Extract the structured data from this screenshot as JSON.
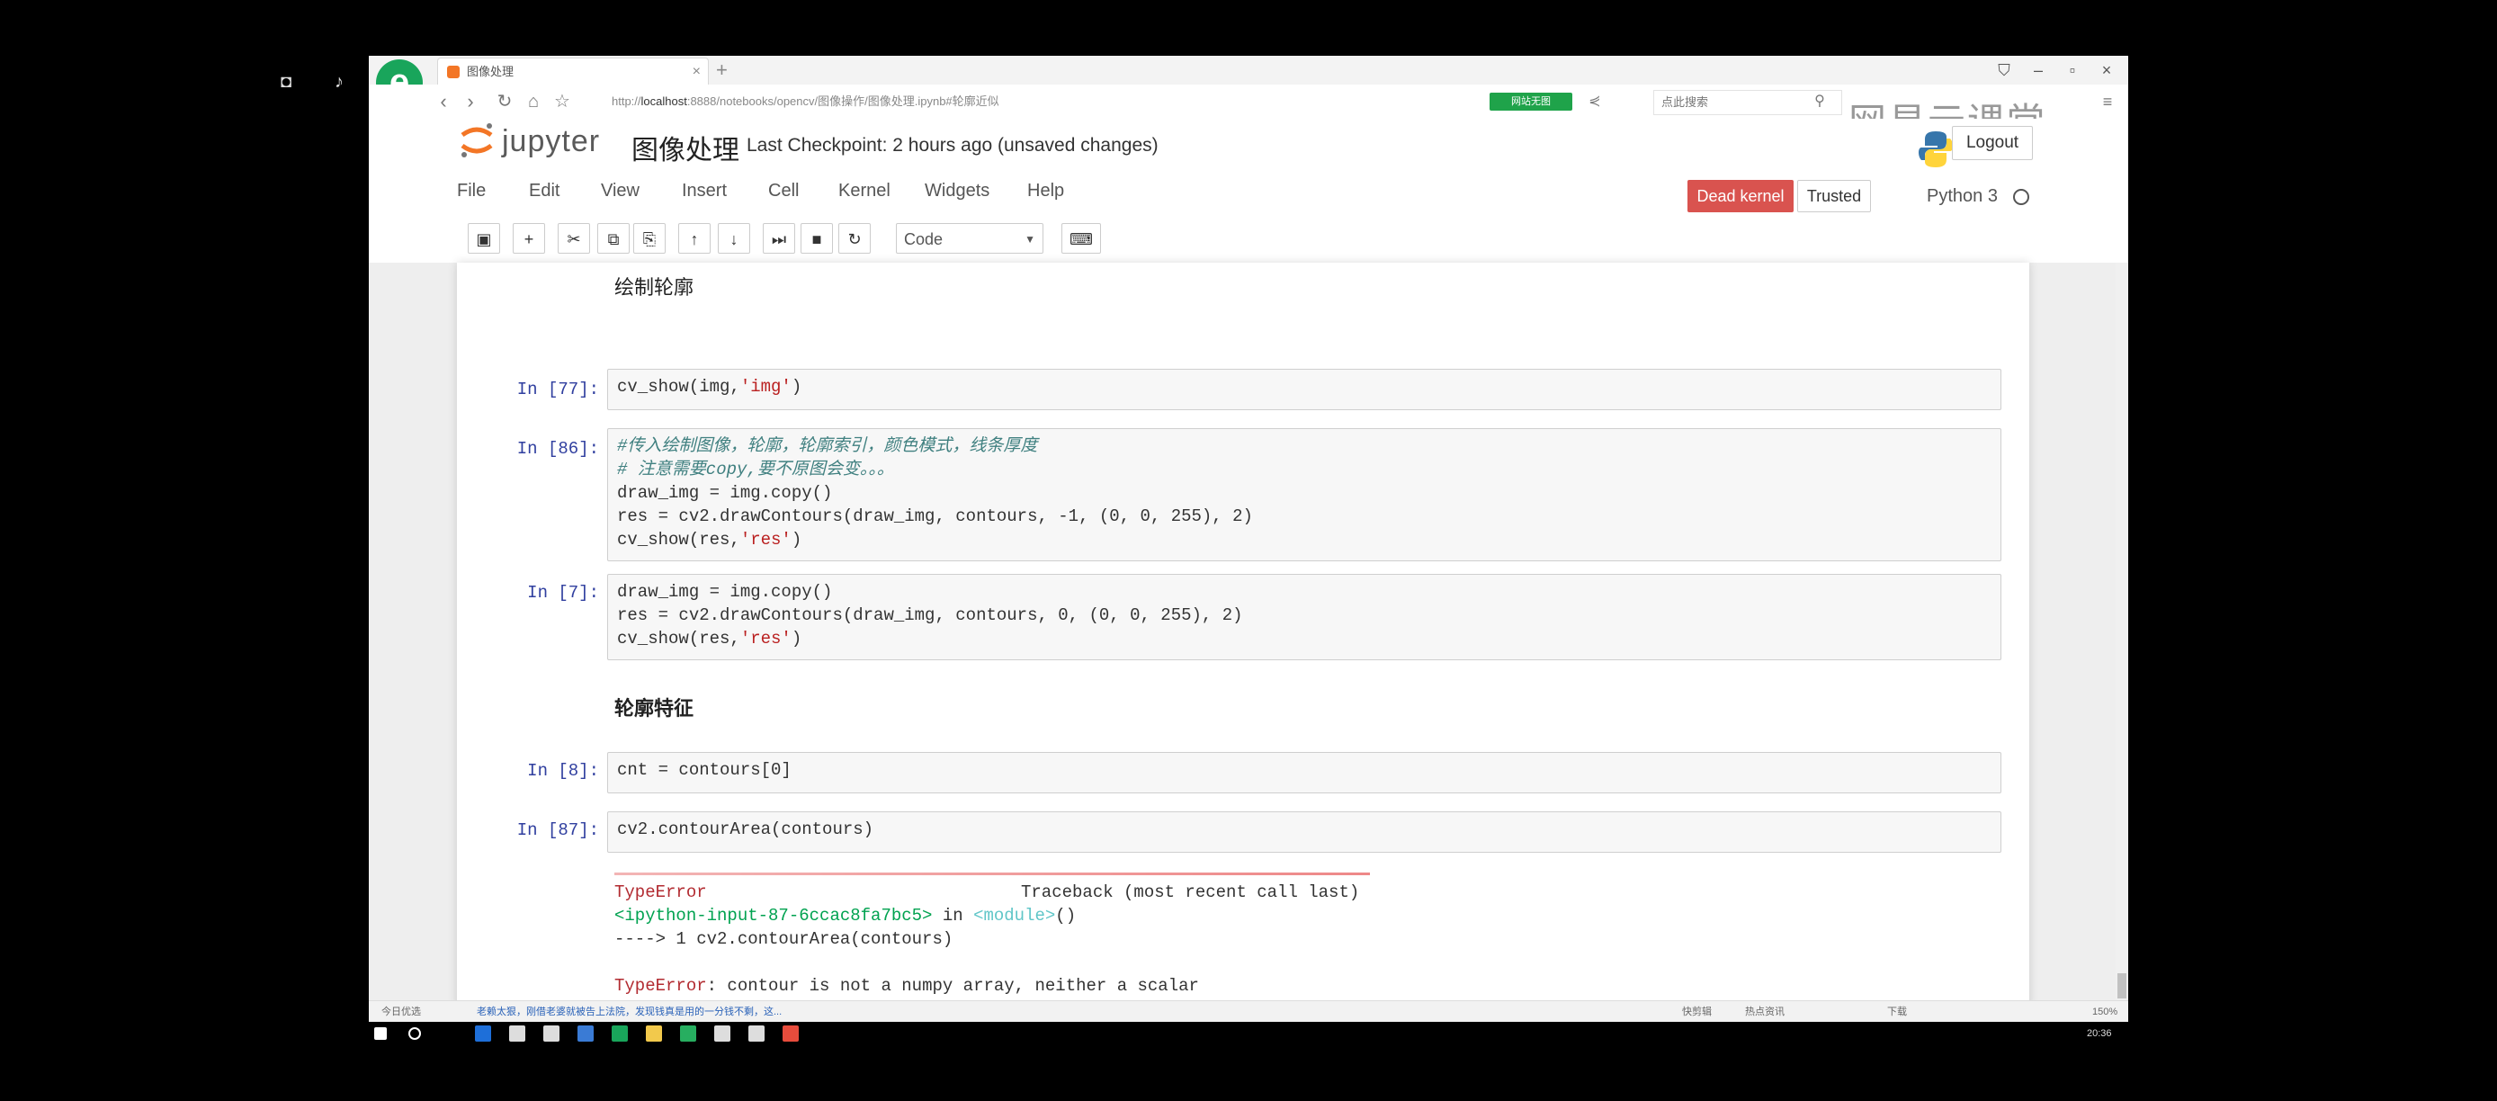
{
  "browser": {
    "tab_title": "图像处理",
    "url_host": "localhost",
    "url_prefix": "http://",
    "url_rest": ":8888/notebooks/opencv/图像操作/图像处理.ipynb#轮廓近似",
    "green_badge": "网站无图",
    "search_placeholder": "点此搜索",
    "new_tab": "+",
    "watermark": "网易云课堂"
  },
  "jupyter": {
    "logo_text": "jupyter",
    "notebook_name": "图像处理",
    "checkpoint": "Last Checkpoint: 2 hours ago (unsaved changes)",
    "logout": "Logout",
    "menus": [
      "File",
      "Edit",
      "View",
      "Insert",
      "Cell",
      "Kernel",
      "Widgets",
      "Help"
    ],
    "dead_kernel": "Dead kernel",
    "trusted": "Trusted",
    "kernel_name": "Python 3",
    "cell_type": "Code"
  },
  "notebook": {
    "md1": "绘制轮廓",
    "md2": "轮廓特征",
    "prompts": [
      "In [77]:",
      "In [86]:",
      "In [7]:",
      "In [8]:",
      "In [87]:"
    ],
    "cell1": [
      "cv_show(img,",
      "'img'",
      ")"
    ],
    "cell2_comment1": "#传入绘制图像，轮廓，轮廓索引，颜色模式，线条厚度",
    "cell2_comment2": "# 注意需要copy,要不原图会变。。。",
    "cell2_line3": "draw_img = img.copy()",
    "cell2_line4": "res = cv2.drawContours(draw_img, contours, -1, (0, 0, 255), 2)",
    "cell2_line5a": "cv_show(res,",
    "cell2_line5b": "'res'",
    "cell2_line5c": ")",
    "cell3_line1": "draw_img = img.copy()",
    "cell3_line2": "res = cv2.drawContours(draw_img, contours, 0, (0, 0, 255), 2)",
    "cell3_line3a": "cv_show(res,",
    "cell3_line3b": "'res'",
    "cell3_line3c": ")",
    "cell4": "cnt = contours[0]",
    "cell5": "cv2.contourArea(contours)",
    "error": {
      "name": "TypeError",
      "traceback": "Traceback (most recent call last)",
      "input_ref": "<ipython-input-87-6ccac8fa7bc5>",
      "in_word": " in ",
      "module": "<module>",
      "parens": "()",
      "arrow_line": "----> 1 cv2.contourArea(contours)",
      "message_name": "TypeError",
      "message": ": contour is not a numpy array, neither a scalar"
    }
  },
  "statusbar": {
    "left": "今日优选",
    "news": "老赖太狠，刚借老婆就被告上法院，发现钱真是用的一分钱不剩，这...",
    "right_items": [
      "快剪辑",
      "热点资讯",
      "下载",
      "150%"
    ]
  },
  "taskbar": {
    "time": "20:36"
  }
}
